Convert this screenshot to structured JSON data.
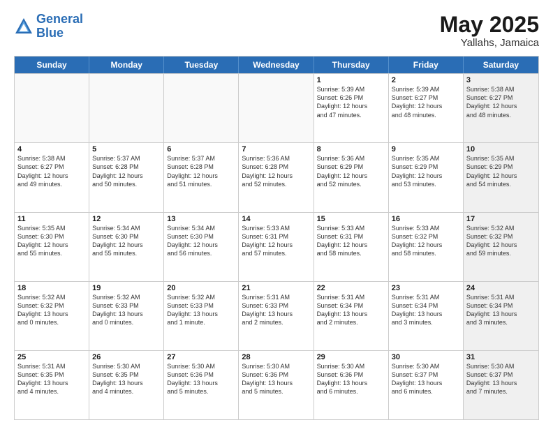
{
  "header": {
    "logo_line1": "General",
    "logo_line2": "Blue",
    "month_year": "May 2025",
    "location": "Yallahs, Jamaica"
  },
  "days_of_week": [
    "Sunday",
    "Monday",
    "Tuesday",
    "Wednesday",
    "Thursday",
    "Friday",
    "Saturday"
  ],
  "rows": [
    [
      {
        "num": "",
        "text": "",
        "empty": true
      },
      {
        "num": "",
        "text": "",
        "empty": true
      },
      {
        "num": "",
        "text": "",
        "empty": true
      },
      {
        "num": "",
        "text": "",
        "empty": true
      },
      {
        "num": "1",
        "text": "Sunrise: 5:39 AM\nSunset: 6:26 PM\nDaylight: 12 hours\nand 47 minutes."
      },
      {
        "num": "2",
        "text": "Sunrise: 5:39 AM\nSunset: 6:27 PM\nDaylight: 12 hours\nand 48 minutes."
      },
      {
        "num": "3",
        "text": "Sunrise: 5:38 AM\nSunset: 6:27 PM\nDaylight: 12 hours\nand 48 minutes.",
        "shaded": true
      }
    ],
    [
      {
        "num": "4",
        "text": "Sunrise: 5:38 AM\nSunset: 6:27 PM\nDaylight: 12 hours\nand 49 minutes."
      },
      {
        "num": "5",
        "text": "Sunrise: 5:37 AM\nSunset: 6:28 PM\nDaylight: 12 hours\nand 50 minutes."
      },
      {
        "num": "6",
        "text": "Sunrise: 5:37 AM\nSunset: 6:28 PM\nDaylight: 12 hours\nand 51 minutes."
      },
      {
        "num": "7",
        "text": "Sunrise: 5:36 AM\nSunset: 6:28 PM\nDaylight: 12 hours\nand 52 minutes."
      },
      {
        "num": "8",
        "text": "Sunrise: 5:36 AM\nSunset: 6:29 PM\nDaylight: 12 hours\nand 52 minutes."
      },
      {
        "num": "9",
        "text": "Sunrise: 5:35 AM\nSunset: 6:29 PM\nDaylight: 12 hours\nand 53 minutes."
      },
      {
        "num": "10",
        "text": "Sunrise: 5:35 AM\nSunset: 6:29 PM\nDaylight: 12 hours\nand 54 minutes.",
        "shaded": true
      }
    ],
    [
      {
        "num": "11",
        "text": "Sunrise: 5:35 AM\nSunset: 6:30 PM\nDaylight: 12 hours\nand 55 minutes."
      },
      {
        "num": "12",
        "text": "Sunrise: 5:34 AM\nSunset: 6:30 PM\nDaylight: 12 hours\nand 55 minutes."
      },
      {
        "num": "13",
        "text": "Sunrise: 5:34 AM\nSunset: 6:30 PM\nDaylight: 12 hours\nand 56 minutes."
      },
      {
        "num": "14",
        "text": "Sunrise: 5:33 AM\nSunset: 6:31 PM\nDaylight: 12 hours\nand 57 minutes."
      },
      {
        "num": "15",
        "text": "Sunrise: 5:33 AM\nSunset: 6:31 PM\nDaylight: 12 hours\nand 58 minutes."
      },
      {
        "num": "16",
        "text": "Sunrise: 5:33 AM\nSunset: 6:32 PM\nDaylight: 12 hours\nand 58 minutes."
      },
      {
        "num": "17",
        "text": "Sunrise: 5:32 AM\nSunset: 6:32 PM\nDaylight: 12 hours\nand 59 minutes.",
        "shaded": true
      }
    ],
    [
      {
        "num": "18",
        "text": "Sunrise: 5:32 AM\nSunset: 6:32 PM\nDaylight: 13 hours\nand 0 minutes."
      },
      {
        "num": "19",
        "text": "Sunrise: 5:32 AM\nSunset: 6:33 PM\nDaylight: 13 hours\nand 0 minutes."
      },
      {
        "num": "20",
        "text": "Sunrise: 5:32 AM\nSunset: 6:33 PM\nDaylight: 13 hours\nand 1 minute."
      },
      {
        "num": "21",
        "text": "Sunrise: 5:31 AM\nSunset: 6:33 PM\nDaylight: 13 hours\nand 2 minutes."
      },
      {
        "num": "22",
        "text": "Sunrise: 5:31 AM\nSunset: 6:34 PM\nDaylight: 13 hours\nand 2 minutes."
      },
      {
        "num": "23",
        "text": "Sunrise: 5:31 AM\nSunset: 6:34 PM\nDaylight: 13 hours\nand 3 minutes."
      },
      {
        "num": "24",
        "text": "Sunrise: 5:31 AM\nSunset: 6:34 PM\nDaylight: 13 hours\nand 3 minutes.",
        "shaded": true
      }
    ],
    [
      {
        "num": "25",
        "text": "Sunrise: 5:31 AM\nSunset: 6:35 PM\nDaylight: 13 hours\nand 4 minutes."
      },
      {
        "num": "26",
        "text": "Sunrise: 5:30 AM\nSunset: 6:35 PM\nDaylight: 13 hours\nand 4 minutes."
      },
      {
        "num": "27",
        "text": "Sunrise: 5:30 AM\nSunset: 6:36 PM\nDaylight: 13 hours\nand 5 minutes."
      },
      {
        "num": "28",
        "text": "Sunrise: 5:30 AM\nSunset: 6:36 PM\nDaylight: 13 hours\nand 5 minutes."
      },
      {
        "num": "29",
        "text": "Sunrise: 5:30 AM\nSunset: 6:36 PM\nDaylight: 13 hours\nand 6 minutes."
      },
      {
        "num": "30",
        "text": "Sunrise: 5:30 AM\nSunset: 6:37 PM\nDaylight: 13 hours\nand 6 minutes."
      },
      {
        "num": "31",
        "text": "Sunrise: 5:30 AM\nSunset: 6:37 PM\nDaylight: 13 hours\nand 7 minutes.",
        "shaded": true
      }
    ]
  ]
}
